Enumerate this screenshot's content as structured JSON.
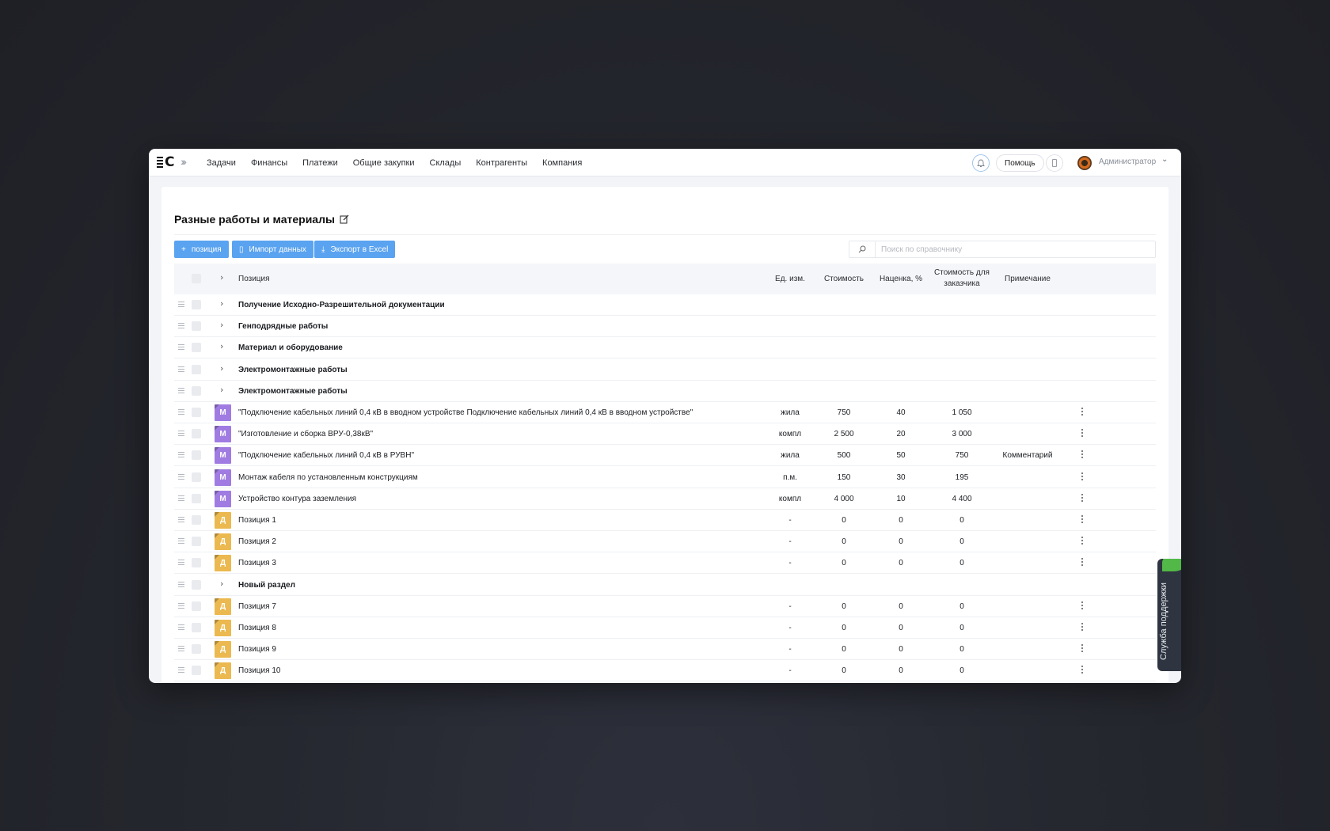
{
  "topbar": {
    "nav": [
      "Задачи",
      "Финансы",
      "Платежи",
      "Общие закупки",
      "Склады",
      "Контрагенты",
      "Компания"
    ],
    "help_label": "Помощь",
    "user_name": "Администратор",
    "icons": [
      "logo",
      "expand-icon",
      "bell-icon",
      "phone-icon",
      "avatar",
      "chevron-down-icon"
    ]
  },
  "page": {
    "title": "Разные работы и материалы",
    "buttons": {
      "add_position": "позиция",
      "import": "Импорт данных",
      "export": "Экспорт в Excel"
    },
    "search_placeholder": "Поиск по справочнику"
  },
  "table": {
    "headers": {
      "position": "Позиция",
      "unit": "Ед. изм.",
      "cost": "Стоимость",
      "markup": "Наценка, %",
      "customer_cost_line1": "Стоимость для",
      "customer_cost_line2": "заказчика",
      "note": "Примечание"
    },
    "rows": [
      {
        "kind": "section",
        "name": "Получение Исходно-Разрешительной документации"
      },
      {
        "kind": "section",
        "name": "Генподрядные работы"
      },
      {
        "kind": "section",
        "name": "Материал и оборудование"
      },
      {
        "kind": "section",
        "name": "Электромонтажные работы"
      },
      {
        "kind": "section",
        "name": "Электромонтажные работы"
      },
      {
        "kind": "item",
        "badge": "М",
        "type": "m",
        "name": "\"Подключение кабельных линий 0,4 кВ в вводном устройстве Подключение кабельных линий 0,4 кВ в вводном устройстве\"",
        "unit": "жила",
        "cost": "750",
        "markup": "40",
        "customer": "1 050",
        "note": ""
      },
      {
        "kind": "item",
        "badge": "М",
        "type": "m",
        "name": "\"Изготовление и сборка ВРУ-0,38кВ\"",
        "unit": "компл",
        "cost": "2 500",
        "markup": "20",
        "customer": "3 000",
        "note": ""
      },
      {
        "kind": "item",
        "badge": "М",
        "type": "m",
        "name": "\"Подключение кабельных линий 0,4 кВ в РУВН\"",
        "unit": "жила",
        "cost": "500",
        "markup": "50",
        "customer": "750",
        "note": "Комментарий"
      },
      {
        "kind": "item",
        "badge": "М",
        "type": "m",
        "name": "Монтаж кабеля по установленным конструкциям",
        "unit": "п.м.",
        "cost": "150",
        "markup": "30",
        "customer": "195",
        "note": ""
      },
      {
        "kind": "item",
        "badge": "М",
        "type": "m",
        "name": "Устройство контура заземления",
        "unit": "компл",
        "cost": "4 000",
        "markup": "10",
        "customer": "4 400",
        "note": ""
      },
      {
        "kind": "item",
        "badge": "Д",
        "type": "d",
        "name": "Позиция 1",
        "unit": "-",
        "cost": "0",
        "markup": "0",
        "customer": "0",
        "note": ""
      },
      {
        "kind": "item",
        "badge": "Д",
        "type": "d",
        "name": "Позиция 2",
        "unit": "-",
        "cost": "0",
        "markup": "0",
        "customer": "0",
        "note": ""
      },
      {
        "kind": "item",
        "badge": "Д",
        "type": "d",
        "name": "Позиция 3",
        "unit": "-",
        "cost": "0",
        "markup": "0",
        "customer": "0",
        "note": ""
      },
      {
        "kind": "section",
        "name": "Новый раздел"
      },
      {
        "kind": "item",
        "badge": "Д",
        "type": "d",
        "name": "Позиция 7",
        "unit": "-",
        "cost": "0",
        "markup": "0",
        "customer": "0",
        "note": ""
      },
      {
        "kind": "item",
        "badge": "Д",
        "type": "d",
        "name": "Позиция 8",
        "unit": "-",
        "cost": "0",
        "markup": "0",
        "customer": "0",
        "note": ""
      },
      {
        "kind": "item",
        "badge": "Д",
        "type": "d",
        "name": "Позиция 9",
        "unit": "-",
        "cost": "0",
        "markup": "0",
        "customer": "0",
        "note": ""
      },
      {
        "kind": "item",
        "badge": "Д",
        "type": "d",
        "name": "Позиция 10",
        "unit": "-",
        "cost": "0",
        "markup": "0",
        "customer": "0",
        "note": ""
      }
    ]
  },
  "support_tab": "Служба поддержки",
  "colors": {
    "accent": "#5aa3f0",
    "badge_m": "#a07ce2",
    "badge_d": "#ebb94f",
    "support_bg": "#2e3440",
    "support_leaf": "#52b848"
  }
}
